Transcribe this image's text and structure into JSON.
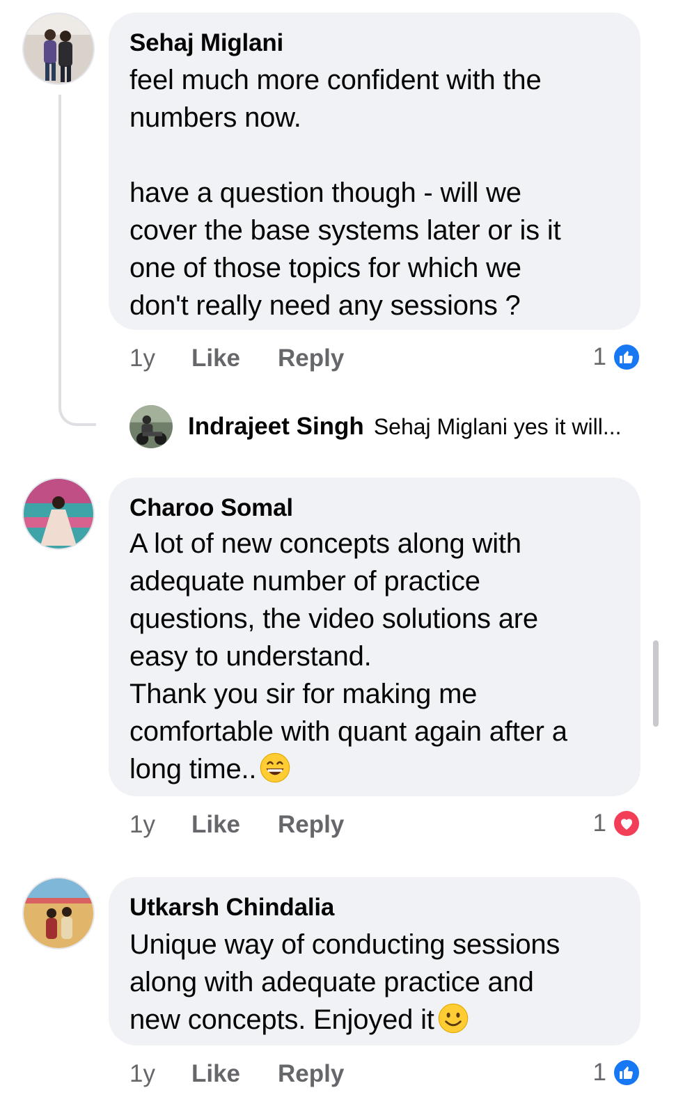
{
  "comments": [
    {
      "author": "Sehaj Miglani",
      "text": "feel much more confident with the\nnumbers now.\n\nhave a question though - will we\ncover the base systems later or is it\none of those topics for which we\ndon't really need any sessions ?",
      "time": "1y",
      "like_label": "Like",
      "reply_label": "Reply",
      "reaction_count": "1",
      "reaction": "like-icon",
      "reply_preview": {
        "author": "Indrajeet Singh",
        "text": "Sehaj Miglani yes it will..."
      }
    },
    {
      "author": "Charoo Somal",
      "text": "A lot of new concepts along with\nadequate number of practice\nquestions, the video solutions are\neasy to understand.\nThank you sir for making me\ncomfortable with quant again after a\nlong time..",
      "emoji": "grinning-sweat-emoji",
      "time": "1y",
      "like_label": "Like",
      "reply_label": "Reply",
      "reaction_count": "1",
      "reaction": "love-icon"
    },
    {
      "author": "Utkarsh Chindalia",
      "text": "Unique way of conducting sessions\nalong with adequate practice and\nnew concepts. Enjoyed it",
      "emoji": "smiling-face-emoji",
      "time": "1y",
      "like_label": "Like",
      "reply_label": "Reply",
      "reaction_count": "1",
      "reaction": "like-icon"
    }
  ],
  "colors": {
    "bubble_bg": "#f0f2f5",
    "meta_text": "#65676b",
    "like_blue": "#1877f2",
    "love_red": "#f33e58"
  }
}
